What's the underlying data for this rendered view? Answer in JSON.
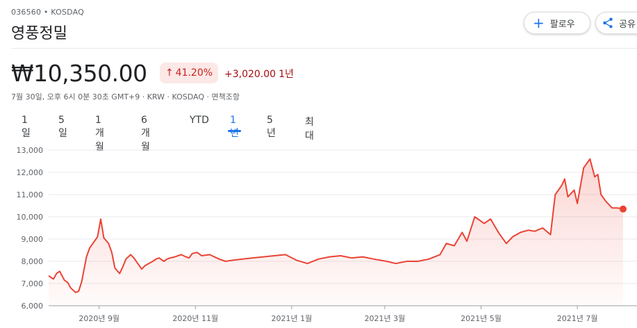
{
  "header": {
    "ticker": "036560 • KOSDAQ",
    "name": "영풍정밀",
    "follow_label": "팔로우",
    "share_label": "공유"
  },
  "quote": {
    "price": "₩10,350.00",
    "change_pct": "41.20%",
    "change_abs": "+3,020.00",
    "period": "1년",
    "meta": "7월 30일, 오후 6시 0분 30초 GMT+9 · KRW · KOSDAQ · 면책조항"
  },
  "tabs": [
    {
      "label": "1일"
    },
    {
      "label": "5일"
    },
    {
      "label": "1개월"
    },
    {
      "label": "6개월"
    },
    {
      "label": "YTD"
    },
    {
      "label": "1년"
    },
    {
      "label": "5년"
    },
    {
      "label": "최대"
    }
  ],
  "active_tab": "1년",
  "colors": {
    "accent": "#1a73e8",
    "line": "#ea4335",
    "down_bg": "#fce8e6",
    "text_red": "#c5221f"
  },
  "chart_data": {
    "type": "area",
    "ylim": [
      6000,
      13000
    ],
    "y_ticks": [
      "6,000",
      "7,000",
      "8,000",
      "9,000",
      "10,000",
      "11,000",
      "12,000",
      "13,000"
    ],
    "x_ticks": [
      "2020년 9월",
      "2020년 11월",
      "2021년 1월",
      "2021년 3월",
      "2021년 5월",
      "2021년 7월"
    ],
    "series": [
      {
        "x": [
          "2020-07-31",
          "2020-08-03",
          "2020-08-05",
          "2020-08-07",
          "2020-08-10",
          "2020-08-12",
          "2020-08-14",
          "2020-08-17",
          "2020-08-19",
          "2020-08-21",
          "2020-08-24",
          "2020-08-26",
          "2020-08-28",
          "2020-08-31",
          "2020-09-02",
          "2020-09-04",
          "2020-09-07",
          "2020-09-09",
          "2020-09-11",
          "2020-09-14",
          "2020-09-16",
          "2020-09-18",
          "2020-09-21",
          "2020-09-23",
          "2020-09-25",
          "2020-09-28",
          "2020-09-30",
          "2020-10-05",
          "2020-10-07",
          "2020-10-09",
          "2020-10-12",
          "2020-10-14",
          "2020-10-16",
          "2020-10-19",
          "2020-10-21",
          "2020-10-23",
          "2020-10-26",
          "2020-10-28",
          "2020-10-30",
          "2020-11-02",
          "2020-11-05",
          "2020-11-10",
          "2020-11-16",
          "2020-11-20",
          "2020-11-25",
          "2020-12-01",
          "2020-12-07",
          "2020-12-14",
          "2020-12-21",
          "2020-12-28",
          "2021-01-04",
          "2021-01-11",
          "2021-01-18",
          "2021-01-25",
          "2021-02-01",
          "2021-02-08",
          "2021-02-15",
          "2021-02-22",
          "2021-03-02",
          "2021-03-08",
          "2021-03-15",
          "2021-03-22",
          "2021-03-29",
          "2021-04-05",
          "2021-04-09",
          "2021-04-14",
          "2021-04-19",
          "2021-04-22",
          "2021-04-27",
          "2021-05-03",
          "2021-05-07",
          "2021-05-12",
          "2021-05-17",
          "2021-05-21",
          "2021-05-26",
          "2021-05-31",
          "2021-06-04",
          "2021-06-09",
          "2021-06-14",
          "2021-06-17",
          "2021-06-21",
          "2021-06-23",
          "2021-06-25",
          "2021-06-29",
          "2021-07-01",
          "2021-07-05",
          "2021-07-07",
          "2021-07-09",
          "2021-07-12",
          "2021-07-14",
          "2021-07-16",
          "2021-07-19",
          "2021-07-21",
          "2021-07-23",
          "2021-07-26",
          "2021-07-28",
          "2021-07-30"
        ],
        "y": [
          7350,
          7200,
          7450,
          7550,
          7150,
          7050,
          6800,
          6600,
          6650,
          7100,
          8200,
          8600,
          8800,
          9100,
          9900,
          9050,
          8800,
          8400,
          7700,
          7450,
          7750,
          8100,
          8300,
          8150,
          7950,
          7650,
          7800,
          8000,
          8100,
          8150,
          8000,
          8100,
          8150,
          8200,
          8250,
          8300,
          8200,
          8150,
          8350,
          8400,
          8250,
          8300,
          8100,
          8000,
          8050,
          8100,
          8150,
          8200,
          8250,
          8300,
          8050,
          7900,
          8100,
          8200,
          8250,
          8150,
          8200,
          8100,
          8000,
          7900,
          8000,
          8000,
          8100,
          8300,
          8800,
          8700,
          9300,
          8900,
          10000,
          9700,
          9900,
          9300,
          8800,
          9100,
          9300,
          9400,
          9350,
          9500,
          9200,
          11000,
          11400,
          11700,
          10900,
          11200,
          10600,
          12200,
          12400,
          12600,
          11800,
          11900,
          11000,
          10700,
          10550,
          10400,
          10400,
          10380,
          10350
        ]
      }
    ]
  }
}
